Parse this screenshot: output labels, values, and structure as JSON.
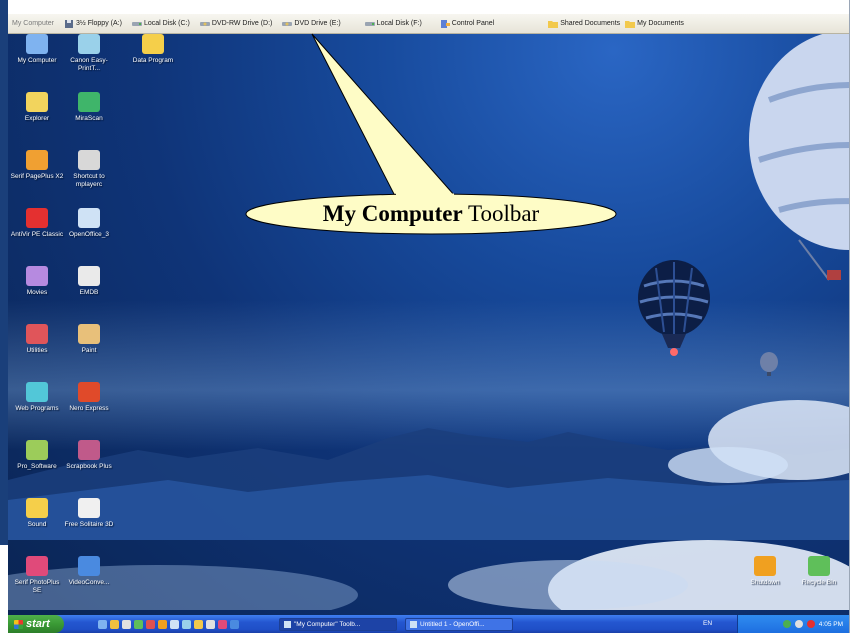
{
  "toolbar": {
    "label": "My Computer",
    "items": [
      {
        "label": "3½ Floppy (A:)",
        "icon": "floppy-icon"
      },
      {
        "label": "Local Disk (C:)",
        "icon": "disk-icon"
      },
      {
        "label": "DVD-RW Drive (D:)",
        "icon": "dvd-icon"
      },
      {
        "label": "DVD Drive (E:)",
        "icon": "dvd-icon"
      },
      {
        "label": "Local Disk (F:)",
        "icon": "disk-icon"
      },
      {
        "label": "Control Panel",
        "icon": "control-panel-icon"
      },
      {
        "label": "Shared Documents",
        "icon": "folder-icon"
      },
      {
        "label": "My Documents",
        "icon": "folder-icon"
      }
    ]
  },
  "callout": {
    "bold": "My Computer",
    "rest": " Toolbar"
  },
  "desktop_icons": [
    {
      "label": "My Computer",
      "icon": "computer-icon",
      "color": "#7fb3f0"
    },
    {
      "label": "Canon Easy-PrintT...",
      "icon": "canon-icon",
      "color": "#9ad1ea"
    },
    {
      "label": "Data Program",
      "icon": "folder-icon",
      "color": "#f5cf4a"
    },
    {
      "label": "Explorer",
      "icon": "explorer-icon",
      "color": "#f2d45d"
    },
    {
      "label": "MiraScan",
      "icon": "mirascan-icon",
      "color": "#3fb56a"
    },
    {
      "label": "Serif PagePlus X2",
      "icon": "pageplus-icon",
      "color": "#f0a032"
    },
    {
      "label": "Shortcut to mplayerc",
      "icon": "mplayer-icon",
      "color": "#d8d8d8"
    },
    {
      "label": "AntiVir PE Classic",
      "icon": "antivir-icon",
      "color": "#e43030"
    },
    {
      "label": "OpenOffice_3",
      "icon": "openoffice-icon",
      "color": "#cfe2f5"
    },
    {
      "label": "Movies",
      "icon": "folder-icon",
      "color": "#b68ae0"
    },
    {
      "label": "EMDB",
      "icon": "clapper-icon",
      "color": "#eaeaea"
    },
    {
      "label": "Utilities",
      "icon": "folder-icon",
      "color": "#e0555a"
    },
    {
      "label": "Paint",
      "icon": "paint-icon",
      "color": "#e8c07a"
    },
    {
      "label": "Web Programs",
      "icon": "folder-icon",
      "color": "#52c7d8"
    },
    {
      "label": "Nero Express",
      "icon": "nero-icon",
      "color": "#e04a2a"
    },
    {
      "label": "Pro_Software",
      "icon": "folder-icon",
      "color": "#9ccc5a"
    },
    {
      "label": "Scrapbook Plus",
      "icon": "scrapbook-icon",
      "color": "#c05a8a"
    },
    {
      "label": "Sound",
      "icon": "folder-icon",
      "color": "#f5cf4a"
    },
    {
      "label": "Free Solitaire 3D",
      "icon": "solitaire-icon",
      "color": "#f0f0f0"
    },
    {
      "label": "Serif PhotoPlus SE",
      "icon": "photoplus-icon",
      "color": "#e04a7a"
    },
    {
      "label": "VideoConve...",
      "icon": "videoconvert-icon",
      "color": "#4a8ae0"
    },
    {
      "label": "Shutdown",
      "icon": "shutdown-icon",
      "color": "#f0a020"
    },
    {
      "label": "Recycle Bin",
      "icon": "recycle-bin-icon",
      "color": "#5fbf5a"
    }
  ],
  "taskbar": {
    "start_label": "start",
    "buttons": [
      {
        "label": "\"My Computer\" Toolb...",
        "active": true
      },
      {
        "label": "Untitled 1 - OpenOffi...",
        "active": false
      }
    ],
    "language": "EN",
    "clock": "4:05 PM"
  }
}
